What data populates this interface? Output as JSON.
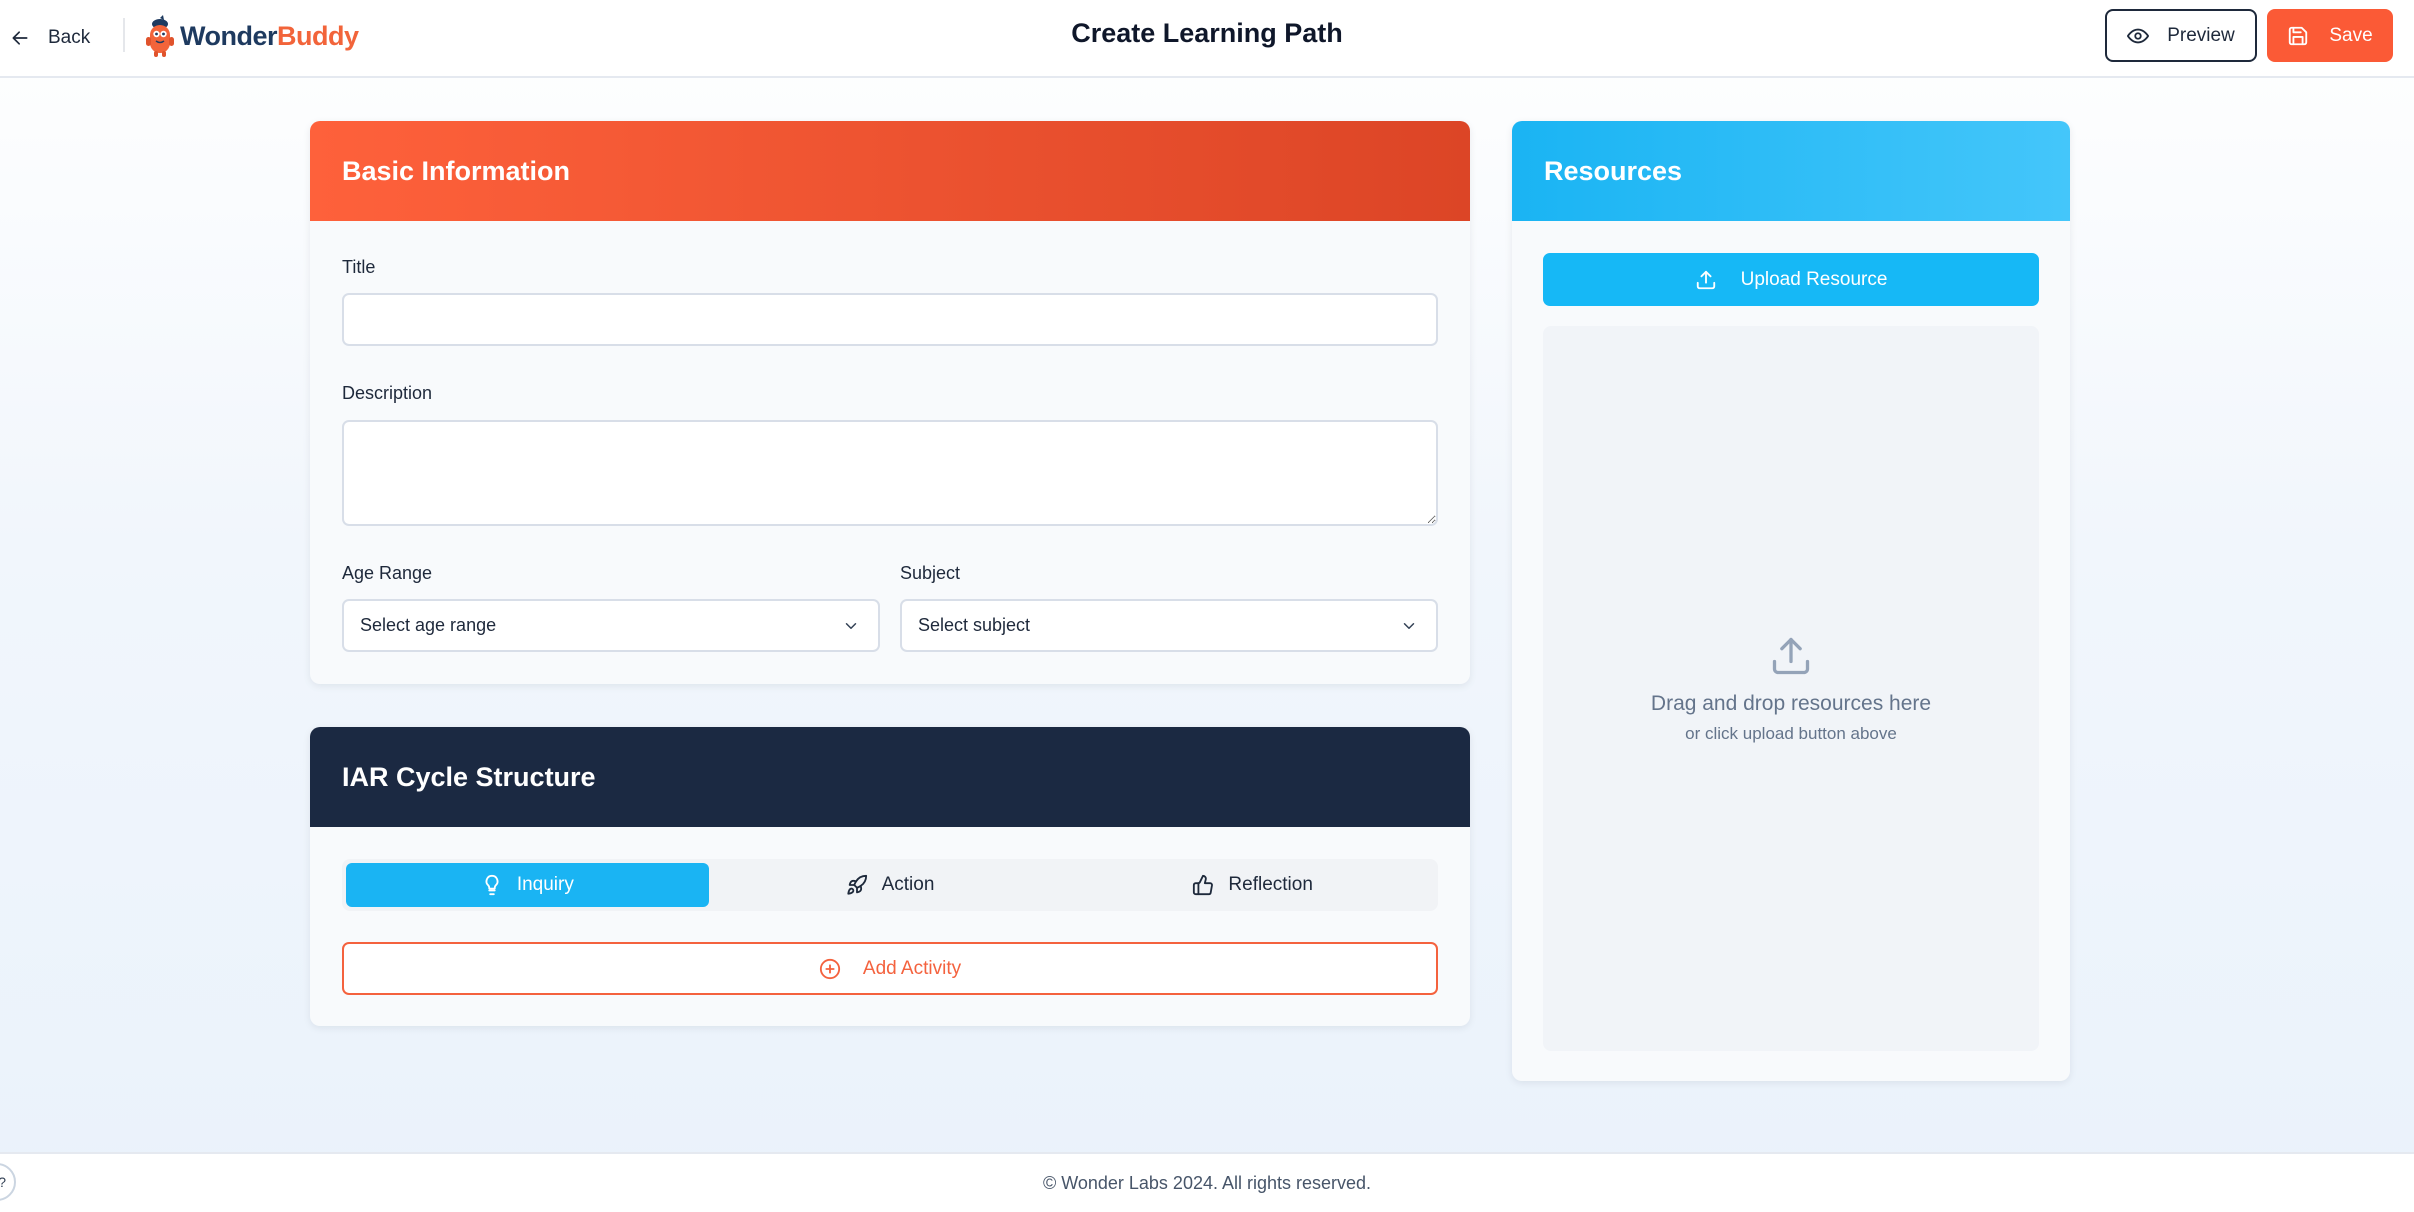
{
  "header": {
    "back_label": "Back",
    "logo": {
      "part1": "Wonder",
      "part2": "Buddy"
    },
    "title": "Create Learning Path",
    "preview_label": "Preview",
    "save_label": "Save"
  },
  "basic_info": {
    "heading": "Basic Information",
    "title_label": "Title",
    "title_value": "",
    "description_label": "Description",
    "description_value": "",
    "age_range_label": "Age Range",
    "age_range_selected": "Select age range",
    "subject_label": "Subject",
    "subject_selected": "Select subject"
  },
  "iar": {
    "heading": "IAR Cycle Structure",
    "tabs": [
      {
        "label": "Inquiry",
        "icon": "lightbulb-icon",
        "active": true
      },
      {
        "label": "Action",
        "icon": "rocket-icon",
        "active": false
      },
      {
        "label": "Reflection",
        "icon": "thumbs-up-icon",
        "active": false
      }
    ],
    "add_activity_label": "Add Activity"
  },
  "resources": {
    "heading": "Resources",
    "upload_label": "Upload Resource",
    "drop_main": "Drag and drop resources here",
    "drop_sub": "or click upload button above"
  },
  "footer": {
    "copyright": "© Wonder Labs 2024. All rights reserved.",
    "help_chip": "?"
  },
  "colors": {
    "accent_orange": "#fb5a36",
    "accent_blue": "#16b8f6",
    "navy": "#1b2942"
  }
}
